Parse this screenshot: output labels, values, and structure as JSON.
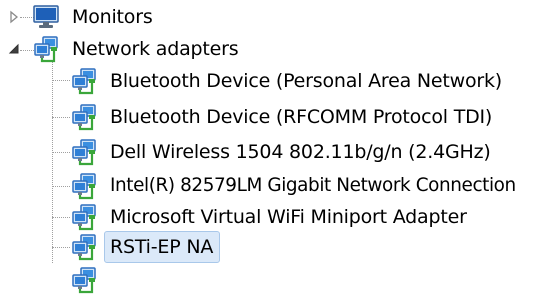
{
  "tree": {
    "categories": [
      {
        "label": "Monitors",
        "expander": "collapsed-triangle-icon",
        "icon": "monitor-icon"
      },
      {
        "label": "Network adapters",
        "expander": "expanded-triangle-icon",
        "icon": "network-adapter-icon"
      }
    ],
    "network_adapters": [
      {
        "label": "Bluetooth Device (Personal Area Network)",
        "icon": "network-adapter-icon"
      },
      {
        "label": "Bluetooth Device (RFCOMM Protocol TDI)",
        "icon": "network-adapter-icon"
      },
      {
        "label": "Dell Wireless 1504 802.11b/g/n (2.4GHz)",
        "icon": "network-adapter-icon"
      },
      {
        "label": "Intel(R) 82579LM Gigabit Network Connection",
        "icon": "network-adapter-icon"
      },
      {
        "label": "Microsoft Virtual WiFi Miniport Adapter",
        "icon": "network-adapter-icon"
      },
      {
        "label": "RSTi-EP NA",
        "icon": "network-adapter-icon",
        "selected": true
      }
    ],
    "colors": {
      "selection_fill": "#dbe9f9",
      "selection_border": "#a9c8ea",
      "adapter_blue": "#2f7fd6",
      "adapter_green": "#3aa63a"
    }
  }
}
